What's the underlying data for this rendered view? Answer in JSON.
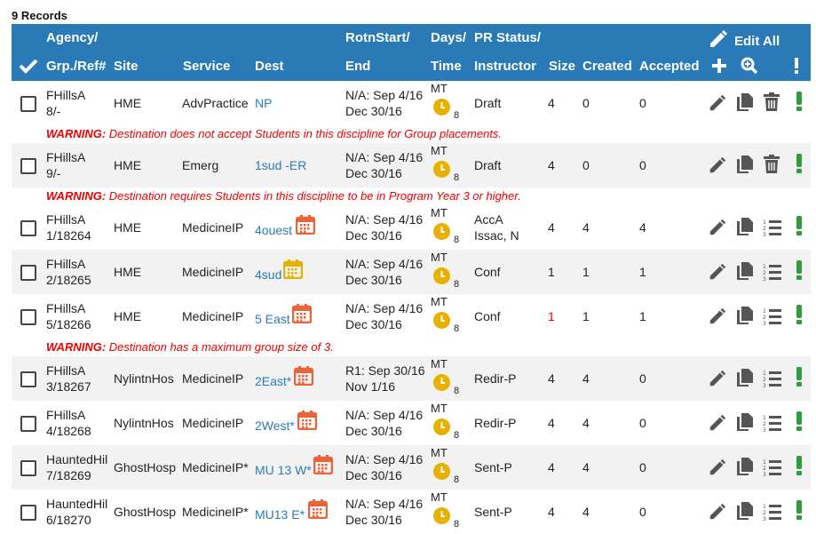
{
  "records_label": "9 Records",
  "header": {
    "agency": "Agency/",
    "grp_ref": "Grp./Ref#",
    "site": "Site",
    "service": "Service",
    "dest": "Dest",
    "rotn_start": "RotnStart/",
    "end": "End",
    "days": "Days/",
    "time": "Time",
    "pr_status": "PR Status/",
    "instructor": "Instructor",
    "size": "Size",
    "created": "Created",
    "accepted": "Accepted",
    "edit_all": "Edit All"
  },
  "rows": [
    {
      "agency": "FHillsA",
      "ref": "8/-",
      "site": "HME",
      "service": "AdvPractice",
      "dest": "NP",
      "dest_icon": "none",
      "start": "N/A: Sep 4/16",
      "end": "Dec 30/16",
      "days": "MT",
      "time": "8",
      "status": "Draft",
      "instructor": "",
      "size": "4",
      "created": "0",
      "accepted": "0",
      "action": "delete-icon",
      "warning_label": "WARNING:",
      "warning": "Destination does not accept Students in this discipline for Group placements."
    },
    {
      "agency": "FHillsA",
      "ref": "9/-",
      "site": "HME",
      "service": "Emerg",
      "dest": "1sud -ER",
      "dest_icon": "none",
      "start": "N/A: Sep 4/16",
      "end": "Dec 30/16",
      "days": "MT",
      "time": "8",
      "status": "Draft",
      "instructor": "",
      "size": "4",
      "created": "0",
      "accepted": "0",
      "action": "delete-icon",
      "warning_label": "WARNING:",
      "warning": "Destination requires Students in this discipline to be in Program Year 3 or higher."
    },
    {
      "agency": "FHillsA",
      "ref": "1/18264",
      "site": "HME",
      "service": "MedicineIP",
      "dest": "4ouest",
      "dest_icon": "orange",
      "start": "N/A: Sep 4/16",
      "end": "Dec 30/16",
      "days": "MT",
      "time": "8",
      "status": "AccA",
      "instructor": "Issac, N",
      "size": "4",
      "created": "4",
      "accepted": "4",
      "action": "list-icon",
      "warning": ""
    },
    {
      "agency": "FHillsA",
      "ref": "2/18265",
      "site": "HME",
      "service": "MedicineIP",
      "dest": "4sud",
      "dest_icon": "yellow",
      "start": "N/A: Sep 4/16",
      "end": "Dec 30/16",
      "days": "MT",
      "time": "8",
      "status": "Conf",
      "instructor": "",
      "size": "1",
      "created": "1",
      "accepted": "1",
      "action": "list-icon",
      "warning": ""
    },
    {
      "agency": "FHillsA",
      "ref": "5/18266",
      "site": "HME",
      "service": "MedicineIP",
      "dest": "5 East",
      "dest_icon": "orange",
      "start": "N/A: Sep 4/16",
      "end": "Dec 30/16",
      "days": "MT",
      "time": "8",
      "status": "Conf",
      "instructor": "",
      "size": "1",
      "size_red": true,
      "created": "1",
      "accepted": "1",
      "action": "list-icon",
      "warning_label": "WARNING:",
      "warning": "Destination has a maximum group size of 3."
    },
    {
      "agency": "FHillsA",
      "ref": "3/18267",
      "site": "NylintnHos",
      "service": "MedicineIP",
      "dest": "2East*",
      "dest_icon": "orange",
      "start": "R1: Sep 30/16",
      "end": "Nov 1/16",
      "days": "MT",
      "time": "8",
      "status": "Redir-P",
      "instructor": "",
      "size": "4",
      "created": "4",
      "accepted": "0",
      "action": "list-icon",
      "warning": ""
    },
    {
      "agency": "FHillsA",
      "ref": "4/18268",
      "site": "NylintnHos",
      "service": "MedicineIP",
      "dest": "2West*",
      "dest_icon": "orange",
      "start": "N/A: Sep 4/16",
      "end": "Dec 30/16",
      "days": "MT",
      "time": "8",
      "status": "Redir-P",
      "instructor": "",
      "size": "4",
      "created": "4",
      "accepted": "0",
      "action": "list-icon",
      "warning": ""
    },
    {
      "agency": "HauntedHil",
      "ref": "7/18269",
      "site": "GhostHosp",
      "service": "MedicineIP*",
      "dest": "MU 13 W*",
      "dest_icon": "orange",
      "start": "N/A: Sep 4/16",
      "end": "Dec 30/16",
      "days": "MT",
      "time": "8",
      "status": "Sent-P",
      "instructor": "",
      "size": "4",
      "created": "4",
      "accepted": "0",
      "action": "list-icon",
      "warning": ""
    },
    {
      "agency": "HauntedHil",
      "ref": "6/18270",
      "site": "GhostHosp",
      "service": "MedicineIP*",
      "dest": "MU13 E*",
      "dest_icon": "orange",
      "start": "N/A: Sep 4/16",
      "end": "Dec 30/16",
      "days": "MT",
      "time": "8",
      "status": "Sent-P",
      "instructor": "",
      "size": "4",
      "created": "4",
      "accepted": "0",
      "action": "list-icon",
      "warning": ""
    }
  ],
  "colors": {
    "header_bg": "#2a7ab8",
    "link": "#2a7ab8",
    "warning": "#e00000",
    "clock": "#e8b100",
    "calendar_orange": "#e8643a",
    "calendar_yellow": "#e8b100",
    "exclaim": "#2e9e3a"
  }
}
